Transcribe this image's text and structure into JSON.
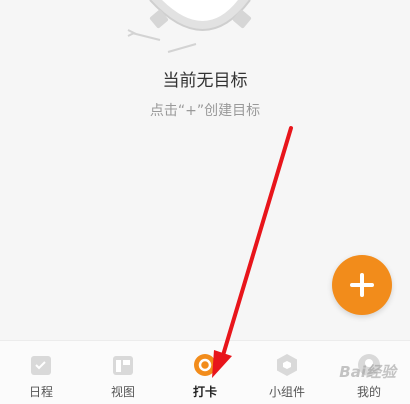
{
  "empty_state": {
    "title": "当前无目标",
    "subtitle": "点击“+”创建目标"
  },
  "fab": {
    "icon": "plus-icon",
    "color": "#f28c1b"
  },
  "tabs": [
    {
      "label": "日程",
      "icon": "calendar-icon"
    },
    {
      "label": "视图",
      "icon": "grid-view-icon"
    },
    {
      "label": "打卡",
      "icon": "checkin-icon",
      "active": true
    },
    {
      "label": "小组件",
      "icon": "widget-icon"
    },
    {
      "label": "我的",
      "icon": "profile-icon"
    }
  ],
  "watermark": {
    "text": "Bai经验"
  },
  "colors": {
    "accent": "#f28c1b",
    "annotation_arrow": "#e8151b"
  }
}
